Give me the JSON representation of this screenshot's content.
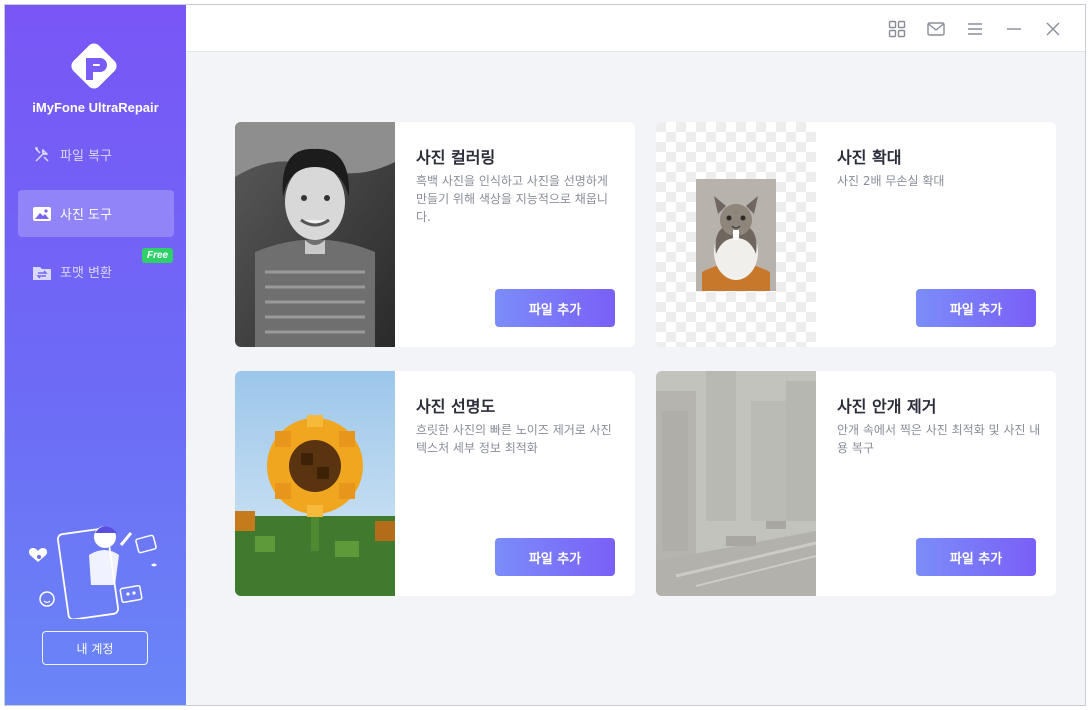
{
  "app": {
    "name": "iMyFone UltraRepair"
  },
  "sidebar": {
    "items": [
      {
        "label": "파일 복구",
        "icon": "tools-icon",
        "active": false
      },
      {
        "label": "사진 도구",
        "icon": "image-icon",
        "active": true
      },
      {
        "label": "포맷 변환",
        "icon": "convert-icon",
        "active": false
      }
    ],
    "free_badge": "Free",
    "account_label": "내 계정"
  },
  "titlebar": {
    "icons": [
      "grid-icon",
      "mail-icon",
      "menu-icon",
      "minimize-icon",
      "close-icon"
    ]
  },
  "cards": [
    {
      "title": "사진 컬러링",
      "description": "흑백 사진을 인식하고 사진을 선명하게 만들기 위해 색상을 지능적으로 채웁니다.",
      "button": "파일 추가",
      "thumbnail": "black-and-white-portrait"
    },
    {
      "title": "사진 확대",
      "description": "사진 2배 무손실 확대",
      "button": "파일 추가",
      "thumbnail": "cat-on-transparent"
    },
    {
      "title": "사진 선명도",
      "description": "흐릿한 사진의 빠른 노이즈 제거로 사진 텍스처 세부 정보 최적화",
      "button": "파일 추가",
      "thumbnail": "pixelated-sunflower"
    },
    {
      "title": "사진 안개 제거",
      "description": "안개 속에서 찍은 사진 최적화 및 사진 내용 복구",
      "button": "파일 추가",
      "thumbnail": "hazy-city"
    }
  ],
  "colors": {
    "sidebar_top": "#7956f6",
    "sidebar_bottom": "#6a86f7",
    "button_start": "#7b8df8",
    "button_end": "#7a5ff7",
    "free_badge": "#2fcf6a",
    "background": "#f3f4f8"
  }
}
